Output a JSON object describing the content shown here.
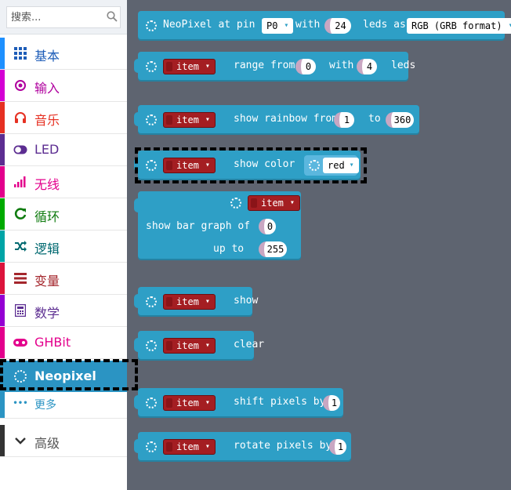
{
  "search": {
    "placeholder": "搜索..."
  },
  "categories": [
    {
      "label": "基本",
      "icon": "grid-icon",
      "color": "#1e90ff",
      "glyph": "▦"
    },
    {
      "label": "输入",
      "icon": "circle-dot-icon",
      "color": "#d400d4",
      "glyph": "◉"
    },
    {
      "label": "音乐",
      "icon": "headphones-icon",
      "color": "#e63022",
      "glyph": "∩"
    },
    {
      "label": "LED",
      "icon": "toggle-icon",
      "color": "#5c2d91",
      "glyph": "◐"
    },
    {
      "label": "无线",
      "icon": "signal-bars-icon",
      "color": "#e3008c",
      "glyph": "▂"
    },
    {
      "label": "循环",
      "icon": "refresh-icon",
      "color": "#00aa00",
      "glyph": "C"
    },
    {
      "label": "逻辑",
      "icon": "shuffle-icon",
      "color": "#00a4a6",
      "glyph": "⨯"
    },
    {
      "label": "变量",
      "icon": "list-icon",
      "color": "#dc143c",
      "glyph": "≡"
    },
    {
      "label": "数学",
      "icon": "calculator-icon",
      "color": "#9400d3",
      "glyph": "▤"
    },
    {
      "label": "GHBit",
      "icon": "gamepad-icon",
      "color": "#e3008c",
      "glyph": "◉"
    },
    {
      "label": "Neopixel",
      "icon": "spinner-icon",
      "color": "#2b94c3",
      "glyph": ""
    },
    {
      "label": "更多",
      "icon": "ellipsis-icon",
      "color": "#2b94c3",
      "glyph": "•••"
    },
    {
      "label": "高级",
      "icon": "chevron-down-icon",
      "color": "#333333",
      "glyph": "⌄"
    }
  ],
  "blocks": {
    "create": {
      "label1": "NeoPixel at pin",
      "pin": "P0",
      "label2": "with",
      "count": "24",
      "label3": "leds as",
      "mode": "RGB (GRB format)"
    },
    "range": {
      "var": "item",
      "label1": "range from",
      "from": "0",
      "label2": "with",
      "count": "4",
      "label3": "leds"
    },
    "rainbow": {
      "var": "item",
      "label1": "show rainbow from",
      "from": "1",
      "label2": "to",
      "to": "360"
    },
    "color": {
      "var": "item",
      "label1": "show color",
      "color": "red"
    },
    "bar": {
      "var": "item",
      "label1": "show bar graph of",
      "value": "0",
      "label2": "up to",
      "high": "255"
    },
    "show": {
      "var": "item",
      "label1": "show"
    },
    "clear": {
      "var": "item",
      "label1": "clear"
    },
    "shift": {
      "var": "item",
      "label1": "shift pixels by",
      "value": "1"
    },
    "rotate": {
      "var": "item",
      "label1": "rotate pixels by",
      "value": "1"
    }
  },
  "colors": {
    "neopixel_block": "#2e9fc6",
    "variable_pill": "#a41e22",
    "workspace_bg": "#5e6470"
  }
}
